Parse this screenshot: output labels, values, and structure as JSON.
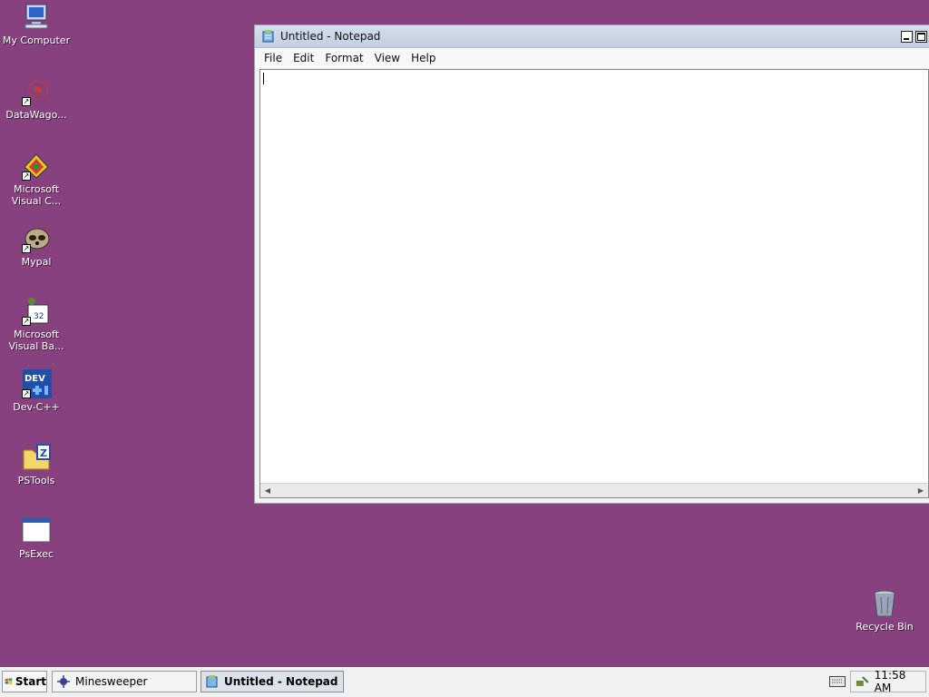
{
  "desktop": {
    "icons": [
      {
        "label": "My Computer",
        "icon": "my-computer-icon"
      },
      {
        "label": "DataWago...",
        "icon": "datawagon-icon"
      },
      {
        "label": "Microsoft\nVisual C...",
        "icon": "visual-cpp-icon"
      },
      {
        "label": "Mypal",
        "icon": "mypal-icon"
      },
      {
        "label": "Microsoft\nVisual Ba...",
        "icon": "visual-basic-icon"
      },
      {
        "label": "Dev-C++",
        "icon": "dev-cpp-icon"
      },
      {
        "label": "PSTools",
        "icon": "folder-icon"
      },
      {
        "label": "PsExec",
        "icon": "window-icon"
      }
    ],
    "recycle_bin": {
      "label": "Recycle Bin",
      "icon": "recycle-bin-icon"
    }
  },
  "notepad": {
    "title": "Untitled - Notepad",
    "menu": [
      "File",
      "Edit",
      "Format",
      "View",
      "Help"
    ],
    "content": ""
  },
  "taskbar": {
    "start_label": "Start",
    "tasks": [
      {
        "label": "Minesweeper",
        "active": false,
        "icon": "minesweeper-icon"
      },
      {
        "label": "Untitled - Notepad",
        "active": true,
        "icon": "notepad-icon"
      }
    ],
    "clock": "11:58 AM"
  },
  "colors": {
    "desktop": "#86417e",
    "title_bar": "#c9d4e3",
    "taskbar": "#eef0f2"
  }
}
